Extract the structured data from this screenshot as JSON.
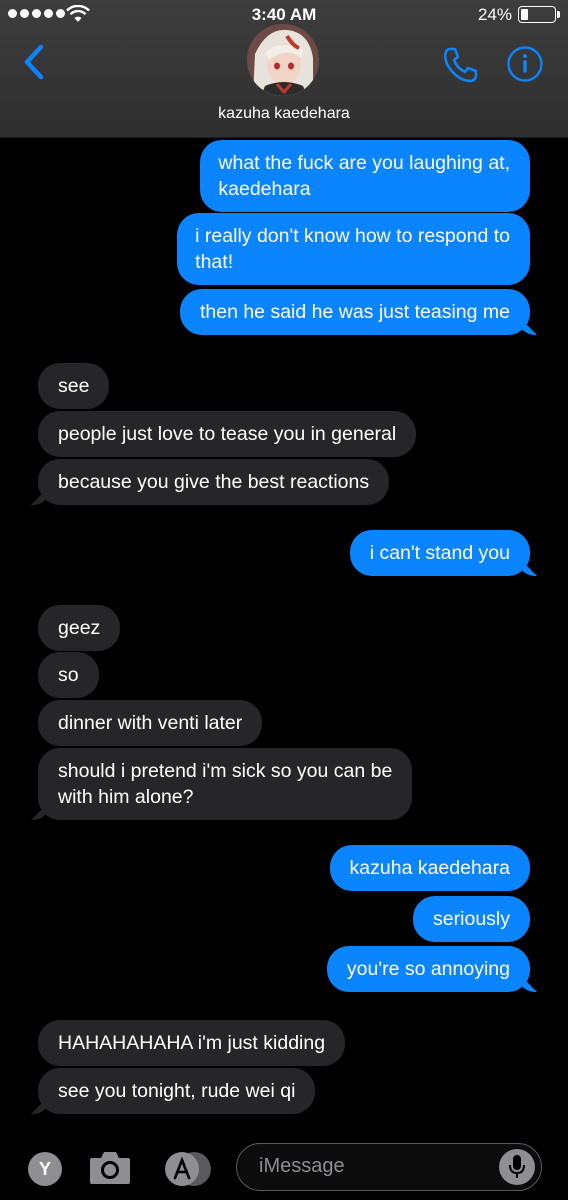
{
  "status_bar": {
    "time": "3:40 AM",
    "battery_percent": "24%",
    "battery_level": 0.24,
    "signal_dots": 5,
    "wifi_icon": "wifi-icon"
  },
  "header": {
    "contact_name": "kazuha kaedehara",
    "back_icon": "chevron-left-icon",
    "call_icon": "phone-icon",
    "info_icon": "info-icon",
    "accent_color": "#0a84ff"
  },
  "messages": [
    {
      "from": "me",
      "text_lines": [
        "what the fuck are you laughing at,",
        "kaedehara"
      ]
    },
    {
      "from": "me",
      "text_lines": [
        "i really don't know how to respond to",
        "that!"
      ]
    },
    {
      "from": "me",
      "text_lines": [
        "then he said he was just teasing me"
      ]
    },
    {
      "from": "them",
      "text_lines": [
        "see"
      ]
    },
    {
      "from": "them",
      "text_lines": [
        "people just love to tease you in general"
      ]
    },
    {
      "from": "them",
      "text_lines": [
        "because you give the best reactions"
      ]
    },
    {
      "from": "me",
      "text_lines": [
        "i can't stand you"
      ]
    },
    {
      "from": "them",
      "text_lines": [
        "geez"
      ]
    },
    {
      "from": "them",
      "text_lines": [
        "so"
      ]
    },
    {
      "from": "them",
      "text_lines": [
        "dinner with venti later"
      ]
    },
    {
      "from": "them",
      "text_lines": [
        "should i pretend i'm sick so you can be",
        "with him alone?"
      ]
    },
    {
      "from": "me",
      "text_lines": [
        "kazuha kaedehara"
      ]
    },
    {
      "from": "me",
      "text_lines": [
        "seriously"
      ]
    },
    {
      "from": "me",
      "text_lines": [
        "you're so annoying"
      ]
    },
    {
      "from": "them",
      "text_lines": [
        "HAHAHAHAHA i'm just kidding"
      ]
    },
    {
      "from": "them",
      "text_lines": [
        "see you tonight, rude wei qi"
      ]
    }
  ],
  "input_bar": {
    "app_y_label": "Y",
    "camera_icon": "camera-icon",
    "appstore_icon": "app-store-icon",
    "placeholder": "iMessage",
    "mic_icon": "microphone-icon"
  },
  "colors": {
    "outgoing_bubble": "#0a84ff",
    "incoming_bubble": "#262628",
    "background": "#000000"
  }
}
